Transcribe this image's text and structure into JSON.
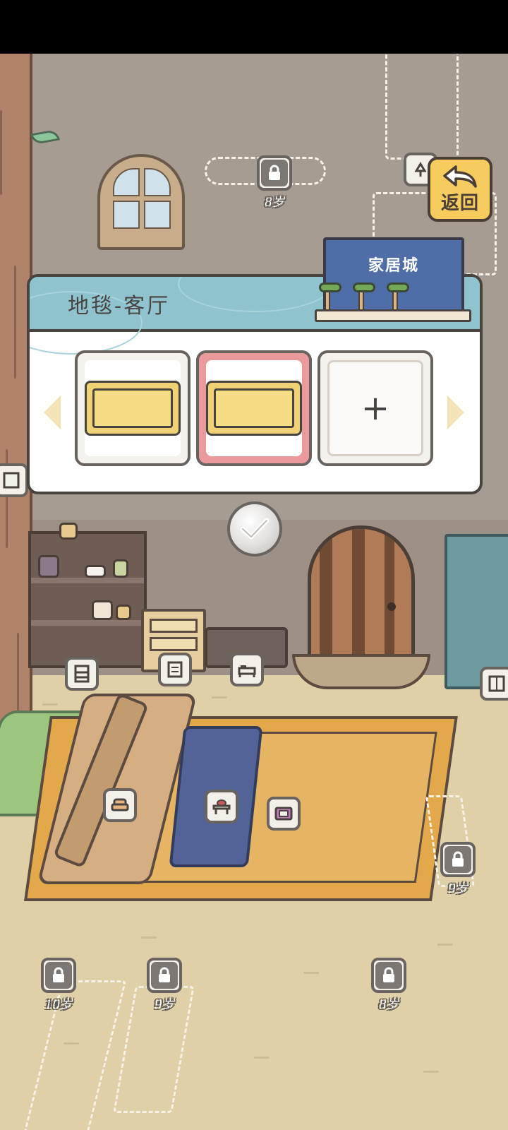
{
  "panel": {
    "title": "地毯-客厅",
    "store_label": "家居城",
    "items": [
      {
        "kind": "rug",
        "selected": false
      },
      {
        "kind": "rug",
        "selected": true
      },
      {
        "kind": "add",
        "label": "+"
      }
    ]
  },
  "back_button": {
    "label": "返回"
  },
  "locks": [
    {
      "age": "8岁"
    },
    {
      "age": "9岁"
    },
    {
      "age": "10岁"
    },
    {
      "age": "9岁"
    },
    {
      "age": "8岁"
    }
  ],
  "slots": [
    {
      "icon": "bookshelf-icon"
    },
    {
      "icon": "drawer-icon"
    },
    {
      "icon": "bed-icon"
    },
    {
      "icon": "cabinet-icon"
    },
    {
      "icon": "armchair-icon"
    },
    {
      "icon": "table-icon"
    },
    {
      "icon": "rug-icon"
    },
    {
      "icon": "frame-icon"
    },
    {
      "icon": "lamp-icon"
    }
  ],
  "colors": {
    "panel_header": "#8fc4cf",
    "selected_card": "#ea9a9a",
    "back_button": "#f6cc5e",
    "store_sign": "#4f6ea8"
  }
}
